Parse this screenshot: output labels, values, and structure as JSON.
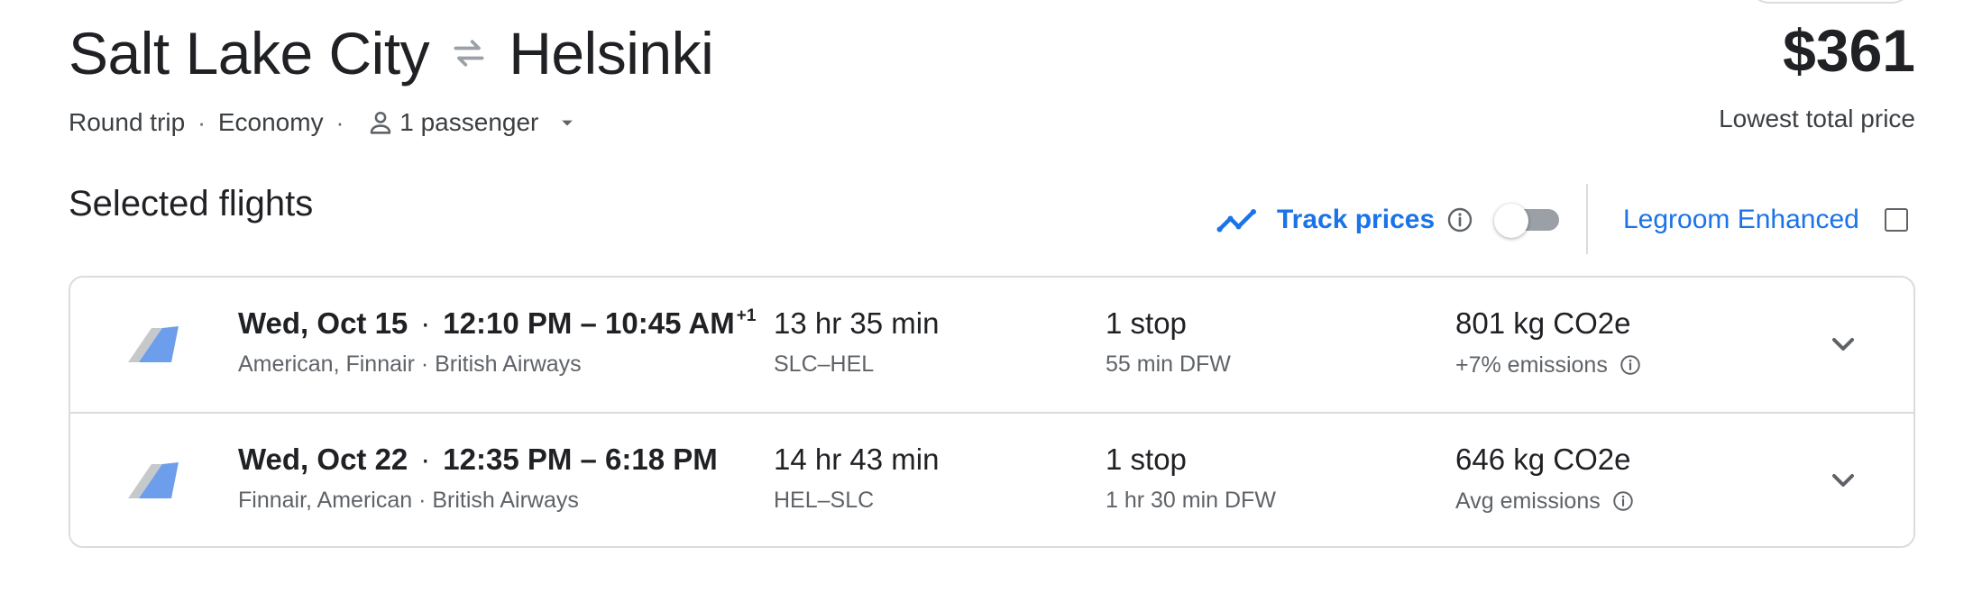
{
  "header": {
    "origin": "Salt Lake City",
    "destination": "Helsinki",
    "trip_type": "Round trip",
    "cabin": "Economy",
    "passengers": "1 passenger",
    "price": "$361",
    "price_label": "Lowest total price",
    "meta_separator": "·"
  },
  "selected": {
    "title": "Selected flights",
    "track_label": "Track prices",
    "track_enabled": false,
    "legroom_label": "Legroom Enhanced",
    "legroom_checked": false
  },
  "flights": [
    {
      "date": "Wed, Oct 15",
      "separator": "·",
      "time_range": "12:10 PM – 10:45 AM",
      "day_offset": "+1",
      "carriers": "American, Finnair · British Airways",
      "duration": "13 hr 35 min",
      "route": "SLC–HEL",
      "stops": "1 stop",
      "layover": "55 min DFW",
      "emissions": "801 kg CO2e",
      "emissions_note": "+7% emissions"
    },
    {
      "date": "Wed, Oct 22",
      "separator": "·",
      "time_range": "12:35 PM – 6:18 PM",
      "day_offset": "",
      "carriers": "Finnair, American · British Airways",
      "duration": "14 hr 43 min",
      "route": "HEL–SLC",
      "stops": "1 stop",
      "layover": "1 hr 30 min DFW",
      "emissions": "646 kg CO2e",
      "emissions_note": "Avg emissions"
    }
  ],
  "colors": {
    "accent": "#1a73e8",
    "text_primary": "#202124",
    "text_secondary": "#5f6368",
    "border": "#dadce0",
    "logo_front": "#6d9eeb",
    "logo_back": "#c6c9cc"
  },
  "icons": {
    "swap": "swap-arrows-icon",
    "person": "person-icon",
    "dropdown": "caret-down-icon",
    "trend": "trend-line-icon",
    "info": "info-icon",
    "expand": "chevron-down-icon",
    "airline": "airline-tail-logo"
  }
}
